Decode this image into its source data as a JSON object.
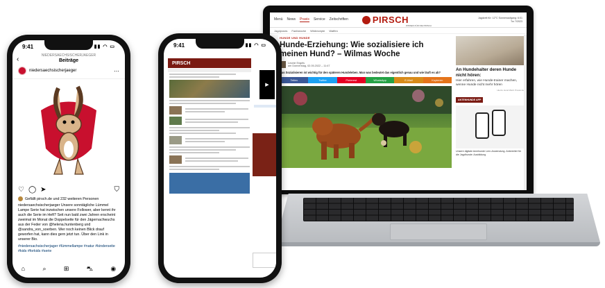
{
  "phone_instagram": {
    "time": "9:41",
    "account_upper": "NIEDERSAECHSISCHERJAEGER",
    "screen_title": "Beiträge",
    "username": "niedersaechsischerjaeger",
    "likes_text": "Gefällt pirsch.de und 232 weiteren Personen",
    "caption": "niedersaechsischerjaeger Unsere sonntägliche Lümmel Lampe Serie hat inzwischen unsere Follower, aber kennt ihr auch die Serie im Heft? Seit nun bald zwei Jahren erscheint zweimal im Monat die Doppelseite für den Jägernachwuchs aus der Feder von @helena.huntenberg und @sandra_von_soerben. Wer noch keinen Blick drauf geworfen hat, kann dies gern jetzt tun. Über den Link in unserer Bio.",
    "hashtags": "#niedersachsischerjager #lümmellampe #natur #kinderseite #kids #forkids #serie"
  },
  "phone_web": {
    "time": "9:41",
    "logo": "PIRSCH"
  },
  "laptop_web": {
    "menu": [
      "Menü",
      "News",
      "Praxis",
      "Service",
      "Zeitschriften"
    ],
    "active_menu_index": 2,
    "logo": "PIRSCH",
    "tagline": "WISSEN FÜR DIE PIRSCH",
    "top_right_line1": "Jagdzeit für: 12°C  Sonnenaufgang: 6:01",
    "top_right_line2": "Trz 7/2023",
    "subnav": [
      "Jagdpraxis",
      "Fanblanche",
      "Wildrezepte",
      "Waffen"
    ],
    "kicker": "HUNDE UND HUNDE",
    "headline": "Hunde-Erziehung: Wie sozialisiere ich meinen Hund? – Wilmas Woche",
    "author": "Leonie Engels",
    "date": "am Donnerstag, 02.05.2022 – 11:47",
    "lead": "Das Sozialisieren ist wichtig für den späteren Hundeleben. Man was bedeutet das eigentlich genau und wie läuft es ab?",
    "share": [
      {
        "label": "Teilen",
        "color": "#3b5998"
      },
      {
        "label": "Twitter",
        "color": "#1da1f2"
      },
      {
        "label": "Pinterest",
        "color": "#e60023"
      },
      {
        "label": "WhatsApp",
        "color": "#25a245"
      },
      {
        "label": "E-Mail",
        "color": "#d88b1a"
      },
      {
        "label": "Kopieren",
        "color": "#e4741b"
      }
    ],
    "side_title": "An Hundehalter deren Hunde nicht hören:",
    "side_text": "Hier erfahren, wie Hunde-trainer machen, wenne Hunde nicht mehr hören",
    "side_source": "Hierzu Hund Werb Provisi de",
    "app_label": "ANTENHUNDE APP",
    "app_text": "Unsere digitale Anmhunde Lern-Anwendung. Anbereitet für die Jagdhunde: Ausbildung"
  }
}
